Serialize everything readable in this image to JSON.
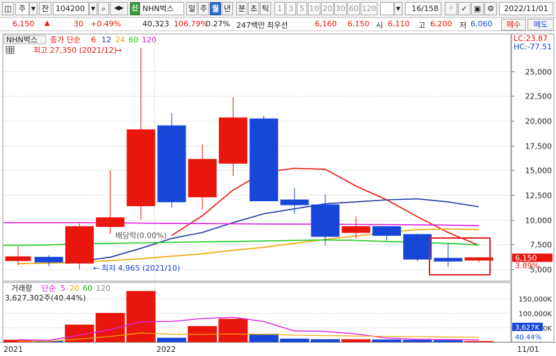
{
  "toolbar": {
    "market_type": "주",
    "market_button": "잔",
    "stock_code": "104200",
    "credit_tag": "신",
    "stock_name": "NHN벅스",
    "period_day": "일",
    "period_week": "주",
    "period_month": "월",
    "period_year": "년",
    "period_minute": "분",
    "period_second": "초",
    "period_tick": "틱",
    "period_numbers": [
      "1",
      "3",
      "5",
      "10",
      "20",
      "30",
      "60",
      "120"
    ],
    "page_counter": "16/158",
    "date": "2022/11/01"
  },
  "quote": {
    "price": "6,150",
    "change_arrow": "▲",
    "change": "30",
    "change_pct": "+0.49%",
    "volume": "40,323",
    "volume_ratio": "106.79%",
    "turnover": "0.27%",
    "amount": "247백만",
    "priority_label": "최우선",
    "ask": "6,160",
    "bid": "6,150",
    "open_label": "시",
    "open": "6,110",
    "high_label": "고",
    "high": "6,200",
    "low_label": "저",
    "low": "6,060",
    "buy_button": "매수",
    "sell_button": "매도"
  },
  "colors": {
    "up": "#e8160c",
    "down": "#1747d8",
    "ma6": "#e8160c",
    "ma12": "#1f3aa6",
    "ma24": "#f0a500",
    "ma60": "#22cc22",
    "ma120": "#e020e0",
    "highlight_box": "#e02020"
  },
  "chart_data": [
    {
      "type": "candlestick",
      "title": "NHN벅스",
      "legend": {
        "label": "종가 단순",
        "periods": [
          "6",
          "12",
          "24",
          "60",
          "120"
        ]
      },
      "annotations": {
        "max_label": "최고 27,350 (2021/12)",
        "min_label": "최저 4,965 (2021/10)",
        "dividend_label": "배당락(0.00%)",
        "lc": "LC:23.87",
        "hc": "HC:-77.51",
        "last_price": "6,150",
        "last_pct": "3.89%"
      },
      "ylim": [
        4000,
        28500
      ],
      "y_ticks": [
        "25,000",
        "22,500",
        "20,000",
        "17,500",
        "15,000",
        "12,500",
        "10,000",
        "7,500",
        "5,000"
      ],
      "y_tick_values": [
        25000,
        22500,
        20000,
        17500,
        15000,
        12500,
        10000,
        7500,
        5000
      ],
      "candles": [
        {
          "o": 5850,
          "h": 7300,
          "l": 5400,
          "c": 6250
        },
        {
          "o": 6200,
          "h": 6400,
          "l": 5300,
          "c": 5700
        },
        {
          "o": 5600,
          "h": 9600,
          "l": 4965,
          "c": 9300
        },
        {
          "o": 9300,
          "h": 15000,
          "l": 8600,
          "c": 10200
        },
        {
          "o": 11400,
          "h": 27350,
          "l": 10000,
          "c": 19100
        },
        {
          "o": 19500,
          "h": 20800,
          "l": 11200,
          "c": 11800
        },
        {
          "o": 12300,
          "h": 17600,
          "l": 11000,
          "c": 16100
        },
        {
          "o": 15700,
          "h": 22400,
          "l": 14400,
          "c": 20300
        },
        {
          "o": 20200,
          "h": 20500,
          "l": 12300,
          "c": 11900
        },
        {
          "o": 12000,
          "h": 13200,
          "l": 10600,
          "c": 11500
        },
        {
          "o": 11500,
          "h": 12600,
          "l": 7400,
          "c": 8300
        },
        {
          "o": 8700,
          "h": 10300,
          "l": 8100,
          "c": 9300
        },
        {
          "o": 9300,
          "h": 9300,
          "l": 7900,
          "c": 8400
        },
        {
          "o": 8500,
          "h": 8600,
          "l": 5800,
          "c": 6000
        },
        {
          "o": 6100,
          "h": 7600,
          "l": 5200,
          "c": 5800
        },
        {
          "o": 5900,
          "h": 6200,
          "l": 5700,
          "c": 6150
        }
      ],
      "ma": {
        "6": [
          null,
          null,
          null,
          null,
          null,
          8400,
          10400,
          13000,
          14800,
          15200,
          15100,
          13400,
          12000,
          10300,
          8700,
          7400
        ],
        "12": [
          null,
          null,
          5800,
          6200,
          7100,
          8100,
          8700,
          9700,
          10600,
          11100,
          11600,
          11800,
          12000,
          12100,
          11800,
          11300
        ],
        "24": [
          5550,
          5600,
          5700,
          5850,
          6050,
          6300,
          6550,
          6900,
          7200,
          7600,
          8000,
          8350,
          8700,
          9000,
          9050,
          9000
        ],
        "60": [
          7400,
          7450,
          7550,
          7600,
          7650,
          7700,
          7750,
          7800,
          7850,
          7900,
          7950,
          7900,
          7800,
          7700,
          7600,
          7450
        ],
        "120": [
          9700,
          9700,
          9700,
          9680,
          9650,
          9620,
          9600,
          9580,
          9560,
          9550,
          9540,
          9520,
          9500,
          9480,
          9450,
          9400
        ]
      }
    },
    {
      "type": "bar",
      "title": "거래량",
      "legend": {
        "label": "단순",
        "periods": [
          "5",
          "20",
          "60",
          "120"
        ]
      },
      "value_label": "3,627,302주(40.44%)",
      "ylim": [
        0,
        190000
      ],
      "y_ticks": [
        "150,000K",
        "100,000K",
        "50,000K"
      ],
      "y_tick_values": [
        150000,
        100000,
        50000
      ],
      "last_volume": "3,627K",
      "last_pct": "40.44%",
      "values": [
        8000,
        4000,
        60000,
        100000,
        175000,
        15000,
        55000,
        80000,
        28000,
        12000,
        10000,
        10000,
        9000,
        8000,
        7000,
        3627
      ],
      "x_labels": [
        "2021",
        "2022",
        "11/01"
      ]
    }
  ]
}
